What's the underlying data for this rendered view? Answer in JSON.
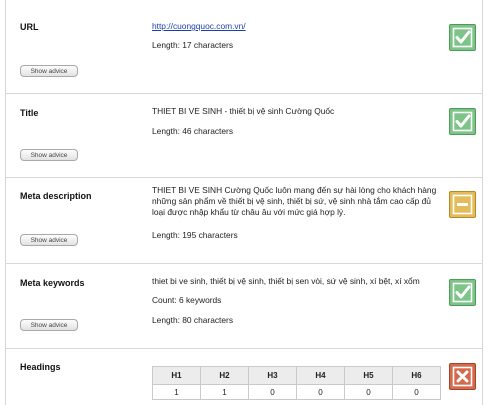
{
  "rows": {
    "url": {
      "label": "URL",
      "link": "http://cuongquoc.com.vn/",
      "length": "Length: 17 characters",
      "advice": "Show advice",
      "status": "ok"
    },
    "title": {
      "label": "Title",
      "text": "THIET BI VE SINH - thiết bị vệ sinh Cường Quốc",
      "length": "Length: 46 characters",
      "advice": "Show advice",
      "status": "ok"
    },
    "meta_description": {
      "label": "Meta description",
      "text": "THIET BI VE SINH Cường Quốc luôn mang đến sự hài lòng cho khách hàng những sản phẩm về thiết bị vệ sinh, thiết bị sứ, vệ sinh nhà tắm cao cấp đủ loại được nhập khẩu từ châu âu với mức giá hợp lý.",
      "length": "Length: 195 characters",
      "advice": "Show advice",
      "status": "warn"
    },
    "meta_keywords": {
      "label": "Meta keywords",
      "text": "thiet bi ve sinh, thiết bị vệ sinh, thiết bị sen vòi, sứ vệ sinh, xí bệt, xí xổm",
      "count": "Count: 6 keywords",
      "length": "Length: 80 characters",
      "advice": "Show advice",
      "status": "ok"
    },
    "headings": {
      "label": "Headings",
      "columns": [
        "H1",
        "H2",
        "H3",
        "H4",
        "H5",
        "H6"
      ],
      "values": [
        "1",
        "1",
        "0",
        "0",
        "0",
        "0"
      ],
      "status": "error"
    }
  },
  "colors": {
    "ok": "#7cc487",
    "warn": "#e4bd5a",
    "error": "#d4694c"
  },
  "icons": {
    "ok": "checkmark-icon",
    "warn": "minus-icon",
    "error": "cross-icon"
  }
}
